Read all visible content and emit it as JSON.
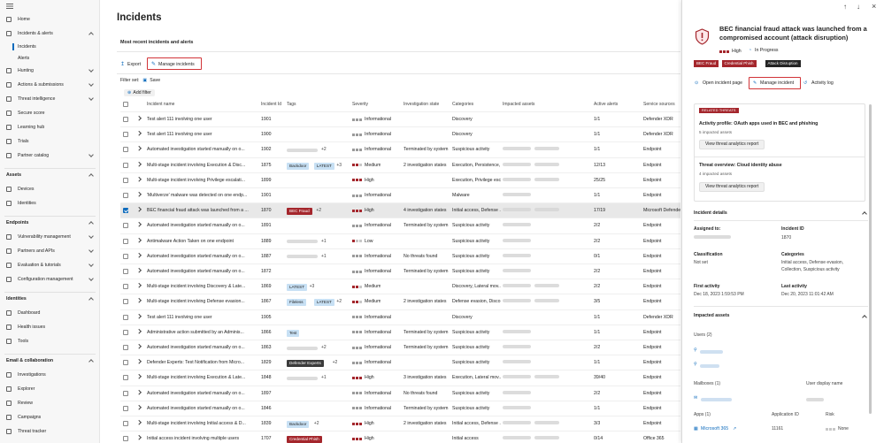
{
  "sidebar": {
    "items": [
      {
        "label": "Home",
        "kind": "item",
        "icon": "home-icon"
      },
      {
        "label": "Incidents & alerts",
        "kind": "group",
        "icon": "shield-icon",
        "expanded": true
      },
      {
        "label": "Incidents",
        "kind": "sub",
        "active": true
      },
      {
        "label": "Alerts",
        "kind": "sub"
      },
      {
        "label": "Hunting",
        "kind": "group",
        "icon": "hunting-icon"
      },
      {
        "label": "Actions & submissions",
        "kind": "group",
        "icon": "actions-icon"
      },
      {
        "label": "Threat intelligence",
        "kind": "group",
        "icon": "intel-icon"
      },
      {
        "label": "Secure score",
        "kind": "item",
        "icon": "trophy-icon"
      },
      {
        "label": "Learning hub",
        "kind": "item",
        "icon": "learning-icon"
      },
      {
        "label": "Trials",
        "kind": "item",
        "icon": "trials-icon"
      },
      {
        "label": "Partner catalog",
        "kind": "group",
        "icon": "partner-icon"
      },
      {
        "label": "Assets",
        "kind": "section",
        "expanded": true
      },
      {
        "label": "Devices",
        "kind": "item",
        "icon": "devices-icon"
      },
      {
        "label": "Identities",
        "kind": "item",
        "icon": "identities-icon"
      },
      {
        "label": "Endpoints",
        "kind": "section",
        "expanded": true
      },
      {
        "label": "Vulnerability management",
        "kind": "group",
        "icon": "vuln-icon"
      },
      {
        "label": "Partners and APIs",
        "kind": "group",
        "icon": "api-icon"
      },
      {
        "label": "Evaluation & tutorials",
        "kind": "group",
        "icon": "eval-icon"
      },
      {
        "label": "Configuration management",
        "kind": "group",
        "icon": "config-icon"
      },
      {
        "label": "Identities",
        "kind": "section",
        "expanded": true
      },
      {
        "label": "Dashboard",
        "kind": "item",
        "icon": "dashboard-icon"
      },
      {
        "label": "Health issues",
        "kind": "item",
        "icon": "health-icon"
      },
      {
        "label": "Tools",
        "kind": "item",
        "icon": "tools-icon"
      },
      {
        "label": "Email & collaboration",
        "kind": "section",
        "expanded": true
      },
      {
        "label": "Investigations",
        "kind": "item",
        "icon": "investigations-icon"
      },
      {
        "label": "Explorer",
        "kind": "item",
        "icon": "explorer-icon"
      },
      {
        "label": "Review",
        "kind": "item",
        "icon": "review-icon"
      },
      {
        "label": "Campaigns",
        "kind": "item",
        "icon": "campaigns-icon"
      },
      {
        "label": "Threat tracker",
        "kind": "item",
        "icon": "tracker-icon"
      }
    ]
  },
  "main": {
    "title": "Incidents",
    "section": "Most recent incidents and alerts",
    "toolbar": {
      "export": "Export",
      "manage": "Manage incidents"
    },
    "filter": {
      "label": "Filter set:",
      "save": "Save",
      "add": "Add filter"
    },
    "columns": [
      "Incident name",
      "Incident Id",
      "Tags",
      "Severity",
      "Investigation state",
      "Categories",
      "Impacted assets",
      "Active alerts",
      "Service sources"
    ],
    "rows": [
      {
        "name": "Test alert 111 involving one user",
        "id": "1901",
        "tags": [],
        "sev": "info",
        "sevText": "Informational",
        "inv": "",
        "cat": "Discovery",
        "assets": 0,
        "alerts": "1/1",
        "src": "Defender XDR"
      },
      {
        "name": "Test alert 111 involving one user",
        "id": "1900",
        "tags": [],
        "sev": "info",
        "sevText": "Informational",
        "inv": "",
        "cat": "Discovery",
        "assets": 0,
        "alerts": "1/1",
        "src": "Defender XDR"
      },
      {
        "name": "Automated investigation started manually on o...",
        "id": "1902",
        "tags": [
          {
            "t": "",
            "c": "blur"
          }
        ],
        "more": "+2",
        "sev": "info",
        "sevText": "Informational",
        "inv": "Terminated by system",
        "cat": "Suspicious activity",
        "assets": 2,
        "alerts": "1/1",
        "src": "Endpoint"
      },
      {
        "name": "Multi-stage incident involving Execution & Disc...",
        "id": "1875",
        "tags": [
          {
            "t": "Backdoor",
            "c": "blue"
          },
          {
            "t": "LATEST",
            "c": "blue"
          }
        ],
        "more": "+3",
        "sev": "med",
        "sevText": "Medium",
        "inv": "2 investigation states",
        "cat": "Execution, Persistence, ...",
        "assets": 2,
        "alerts": "12/13",
        "src": "Endpoint"
      },
      {
        "name": "Multi-stage incident involving Privilege escalati...",
        "id": "1899",
        "tags": [],
        "sev": "high",
        "sevText": "High",
        "inv": "",
        "cat": "Execution, Privilege esc...",
        "assets": 2,
        "alerts": "25/25",
        "src": "Endpoint"
      },
      {
        "name": "'Multiverze' malware was detected on one endp...",
        "id": "1901",
        "tags": [],
        "sev": "info",
        "sevText": "Informational",
        "inv": "",
        "cat": "Malware",
        "assets": 1,
        "alerts": "1/1",
        "src": "Endpoint"
      },
      {
        "name": "BEC financial fraud attack was launched from a ...",
        "id": "1870",
        "tags": [
          {
            "t": "BEC Fraud",
            "c": "red"
          }
        ],
        "more": "+2",
        "sev": "high",
        "sevText": "High",
        "inv": "4 investigation states",
        "cat": "Initial access, Defense ...",
        "assets": 2,
        "alerts": "17/19",
        "src": "Microsoft Defender",
        "selected": true
      },
      {
        "name": "Automated investigation started manually on o...",
        "id": "1891",
        "tags": [],
        "sev": "info",
        "sevText": "Informational",
        "inv": "Terminated by system",
        "cat": "Suspicious activity",
        "assets": 1,
        "alerts": "2/2",
        "src": "Endpoint"
      },
      {
        "name": "Antimalware Action Taken on one endpoint",
        "id": "1889",
        "tags": [
          {
            "t": "",
            "c": "blur"
          }
        ],
        "more": "+1",
        "sev": "low",
        "sevText": "Low",
        "inv": "",
        "cat": "Suspicious activity",
        "assets": 1,
        "alerts": "2/2",
        "src": "Endpoint"
      },
      {
        "name": "Automated investigation started manually on o...",
        "id": "1887",
        "tags": [
          {
            "t": "",
            "c": "blur"
          }
        ],
        "more": "+1",
        "sev": "info",
        "sevText": "Informational",
        "inv": "No threats found",
        "cat": "Suspicious activity",
        "assets": 1,
        "alerts": "0/1",
        "src": "Endpoint"
      },
      {
        "name": "Automated investigation started manually on o...",
        "id": "1872",
        "tags": [],
        "sev": "info",
        "sevText": "Informational",
        "inv": "Terminated by system",
        "cat": "Suspicious activity",
        "assets": 1,
        "alerts": "2/2",
        "src": "Endpoint"
      },
      {
        "name": "Multi-stage incident involving Discovery & Late...",
        "id": "1869",
        "tags": [
          {
            "t": "LATEST",
            "c": "blue"
          }
        ],
        "more": "+3",
        "sev": "med",
        "sevText": "Medium",
        "inv": "",
        "cat": "Discovery, Lateral mov...",
        "assets": 2,
        "alerts": "2/2",
        "src": "Endpoint"
      },
      {
        "name": "Multi-stage incident involving Defense evasion...",
        "id": "1867",
        "tags": [
          {
            "t": "Fileless",
            "c": "blue"
          },
          {
            "t": "LATEST",
            "c": "blue"
          }
        ],
        "more": "+2",
        "sev": "med",
        "sevText": "Medium",
        "inv": "2 investigation states",
        "cat": "Defense evasion, Disco...",
        "assets": 2,
        "alerts": "3/5",
        "src": "Endpoint"
      },
      {
        "name": "Test alert 111 involving one user",
        "id": "1905",
        "tags": [],
        "sev": "info",
        "sevText": "Informational",
        "inv": "",
        "cat": "Discovery",
        "assets": 0,
        "alerts": "1/1",
        "src": "Defender XDR"
      },
      {
        "name": "Administrative action submitted by an Adminis...",
        "id": "1866",
        "tags": [
          {
            "t": "Test",
            "c": "blue"
          }
        ],
        "sev": "info",
        "sevText": "Informational",
        "inv": "Terminated by system",
        "cat": "Suspicious activity",
        "assets": 1,
        "alerts": "1/1",
        "src": "Endpoint"
      },
      {
        "name": "Automated investigation started manually on o...",
        "id": "1863",
        "tags": [
          {
            "t": "",
            "c": "blur"
          }
        ],
        "more": "+2",
        "sev": "info",
        "sevText": "Informational",
        "inv": "Terminated by system",
        "cat": "Suspicious activity",
        "assets": 1,
        "alerts": "2/2",
        "src": "Endpoint"
      },
      {
        "name": "Defender Experts: Test Notification from Micro...",
        "id": "1829",
        "tags": [
          {
            "t": "Defender Experts",
            "c": "dark"
          }
        ],
        "more": "+2",
        "sev": "info",
        "sevText": "Informational",
        "inv": "",
        "cat": "Suspicious activity",
        "assets": 1,
        "alerts": "1/1",
        "src": "Endpoint"
      },
      {
        "name": "Multi-stage incident involving Execution & Late...",
        "id": "1848",
        "tags": [
          {
            "t": "",
            "c": "blur"
          }
        ],
        "more": "+1",
        "sev": "high",
        "sevText": "High",
        "inv": "3 investigation states",
        "cat": "Execution, Lateral mov...",
        "assets": 2,
        "alerts": "39/40",
        "src": "Endpoint"
      },
      {
        "name": "Automated investigation started manually on o...",
        "id": "1897",
        "tags": [],
        "sev": "info",
        "sevText": "Informational",
        "inv": "No threats found",
        "cat": "Suspicious activity",
        "assets": 1,
        "alerts": "2/2",
        "src": "Endpoint"
      },
      {
        "name": "Automated investigation started manually on o...",
        "id": "1846",
        "tags": [],
        "sev": "info",
        "sevText": "Informational",
        "inv": "Terminated by system",
        "cat": "Suspicious activity",
        "assets": 1,
        "alerts": "1/1",
        "src": "Endpoint"
      },
      {
        "name": "Multi-stage incident involving Initial access & D...",
        "id": "1839",
        "tags": [
          {
            "t": "Backdoor",
            "c": "blue"
          }
        ],
        "more": "+2",
        "sev": "high",
        "sevText": "High",
        "inv": "2 investigation states",
        "cat": "Initial access, Defense ...",
        "assets": 2,
        "alerts": "3/3",
        "src": "Endpoint"
      },
      {
        "name": "Initial access incident involving multiple users",
        "id": "1707",
        "tags": [
          {
            "t": "Credential Phish",
            "c": "red"
          }
        ],
        "sev": "high",
        "sevText": "High",
        "inv": "",
        "cat": "Initial access",
        "assets": 2,
        "alerts": "0/14",
        "src": "Office 365"
      }
    ]
  },
  "panel": {
    "title": "BEC financial fraud attack was launched from a compromised account (attack disruption)",
    "severity": "High",
    "status": "In Progress",
    "tags": [
      {
        "label": "BEC Fraud",
        "color": "#a4262c"
      },
      {
        "label": "Credential Phish",
        "color": "#a4262c"
      },
      {
        "label": "Attack Disruption",
        "color": "#242424"
      }
    ],
    "actions": {
      "open": "Open incident page",
      "manage": "Manage incident",
      "log": "Activity log"
    },
    "threats_badge": "RELATED THREATS",
    "threat1": {
      "title": "Activity profile: OAuth apps used in BEC and phishing",
      "sub": "5 impacted assets",
      "btn": "View threat analytics report"
    },
    "threat2": {
      "title": "Threat overview: Cloud identity abuse",
      "sub": "4 impacted assets",
      "btn": "View threat analytics report"
    },
    "details_title": "Incident details",
    "assigned_label": "Assigned to:",
    "incident_id_label": "Incident ID",
    "incident_id": "1870",
    "classification_label": "Classification",
    "classification": "Not set",
    "categories_label": "Categories",
    "categories": "Initial access, Defense evasion,",
    "categories2": "Collection, Suspicious activity",
    "first_label": "First activity",
    "first": "Dec 18, 2023 1:59:53 PM",
    "last_label": "Last activity",
    "last": "Dec 20, 2023 11:01:42 AM",
    "impacted_title": "Impacted assets",
    "users_label": "Users (2)",
    "mailboxes_label": "Mailboxes (1)",
    "user_display_label": "User display name",
    "apps_label": "Apps (1)",
    "app_id_label": "Application ID",
    "risk_label": "Risk",
    "app_name": "Microsoft 365",
    "app_id": "11161",
    "risk": "None"
  }
}
